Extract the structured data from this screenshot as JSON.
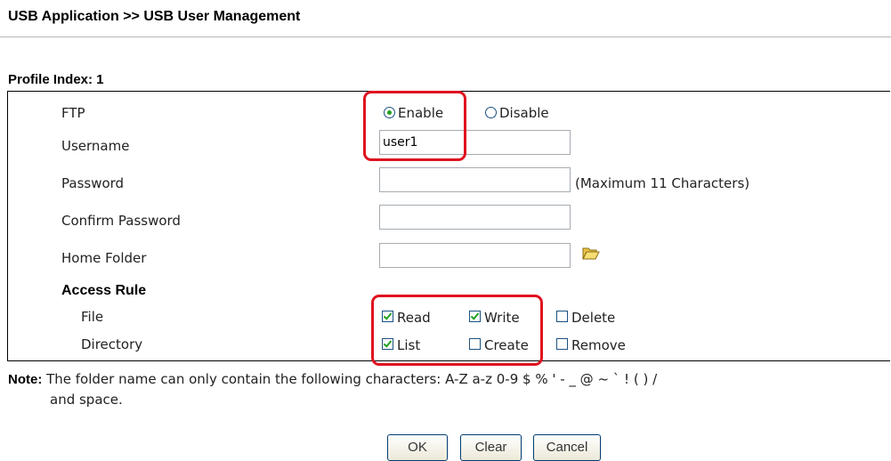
{
  "page": {
    "title": "USB Application >> USB User Management"
  },
  "profile": {
    "label": "Profile Index: 1"
  },
  "form": {
    "ftp": {
      "label": "FTP",
      "enable_label": "Enable",
      "disable_label": "Disable",
      "selected": "Enable"
    },
    "username": {
      "label": "Username",
      "value": "user1"
    },
    "password": {
      "label": "Password",
      "value": "",
      "hint": "(Maximum 11 Characters)"
    },
    "confirm_password": {
      "label": "Confirm Password",
      "value": ""
    },
    "home_folder": {
      "label": "Home Folder",
      "value": "",
      "icon": "folder-open-icon"
    },
    "access_rule": {
      "label": "Access Rule",
      "file": {
        "label": "File",
        "read": {
          "label": "Read",
          "checked": true
        },
        "write": {
          "label": "Write",
          "checked": true
        },
        "delete": {
          "label": "Delete",
          "checked": false
        }
      },
      "directory": {
        "label": "Directory",
        "list": {
          "label": "List",
          "checked": true
        },
        "create": {
          "label": "Create",
          "checked": false
        },
        "remove": {
          "label": "Remove",
          "checked": false
        }
      }
    }
  },
  "note": {
    "prefix": "Note:",
    "text": "The folder name can only contain the following characters: A-Z a-z 0-9 $ % ' - _ @ ~ ` ! ( ) /",
    "text2": "and space."
  },
  "buttons": {
    "ok": "OK",
    "clear": "Clear",
    "cancel": "Cancel"
  },
  "colors": {
    "highlight": "#e0121f",
    "check": "#21a121",
    "border": "#000000"
  }
}
